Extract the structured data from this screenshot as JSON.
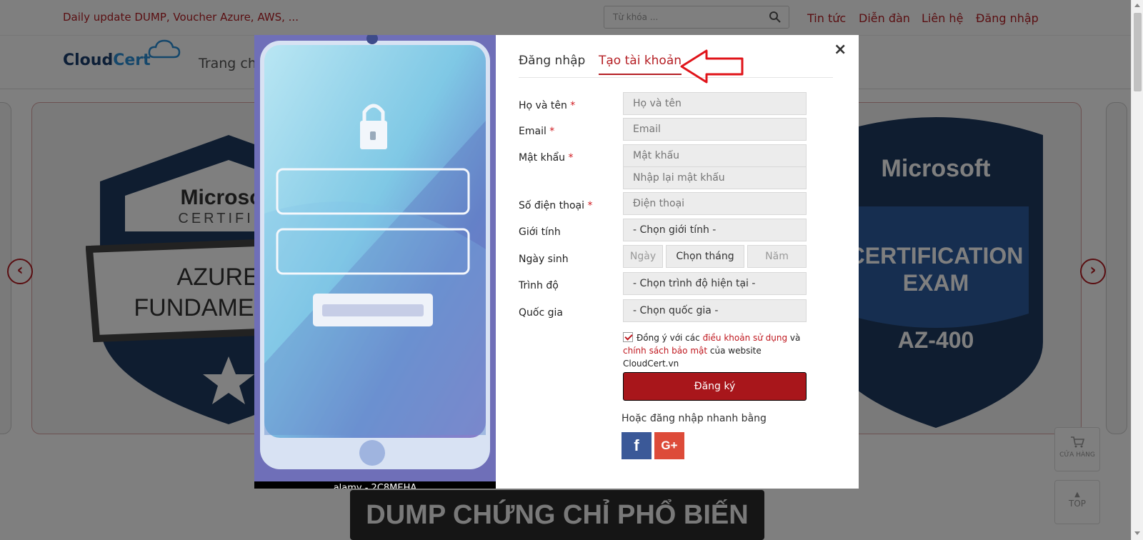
{
  "header": {
    "promo": "Daily update DUMP, Voucher Azure, AWS, ...",
    "search_placeholder": "Từ khóa ...",
    "nav": [
      "Tin tức",
      "Diễn đàn",
      "Liên hệ",
      "Đăng nhập"
    ]
  },
  "logo": {
    "part1": "Cloud",
    "part2": "Cert"
  },
  "menu": {
    "first": "Trang chủ"
  },
  "banner": {
    "left_brand": "Microsoft",
    "left_certified": "CERTIFIED",
    "left_line1": "AZURE AI",
    "left_line2": "FUNDAMENTALS",
    "right_brand": "Microsoft",
    "right_line1": "CERTIFICATION",
    "right_line2": "EXAM",
    "right_code": "AZ-400"
  },
  "section_title": "DUMP CHỨNG CHỈ PHỔ BIẾN",
  "floating": {
    "cart_label": "CỬA HÀNG",
    "top_label": "TOP"
  },
  "modal": {
    "image_caption": "alamy - 2C8MEHA",
    "tabs": [
      {
        "label": "Đăng nhập",
        "active": false
      },
      {
        "label": "Tạo tài khoản",
        "active": true
      }
    ],
    "close": "×",
    "labels": {
      "fullname": "Họ và tên",
      "email": "Email",
      "password": "Mật khẩu",
      "phone": "Số điện thoại",
      "gender": "Giới tính",
      "birthday": "Ngày sinh",
      "level": "Trình độ",
      "country": "Quốc gia"
    },
    "required_mark": "*",
    "placeholders": {
      "fullname": "Họ và tên",
      "email": "Email",
      "password": "Mật khẩu",
      "password_confirm": "Nhập lại mật khẩu",
      "phone": "Điện thoại",
      "day": "Ngày",
      "month": "Chọn tháng",
      "year": "Năm"
    },
    "selects": {
      "gender": "- Chọn giới tính -",
      "level": "- Chọn trình độ hiện tại -",
      "country": "- Chọn quốc gia -"
    },
    "agree": {
      "prefix": "Đồng ý với các ",
      "terms": "điều khoản sử dụng",
      "and": " và",
      "privacy": "chính sách bảo mật",
      "suffix": " của website CloudCert.vn",
      "checked": true
    },
    "submit": "Đăng ký",
    "quick_login": "Hoặc đăng nhập nhanh bằng",
    "social": {
      "facebook": "f",
      "google": "G+"
    }
  }
}
